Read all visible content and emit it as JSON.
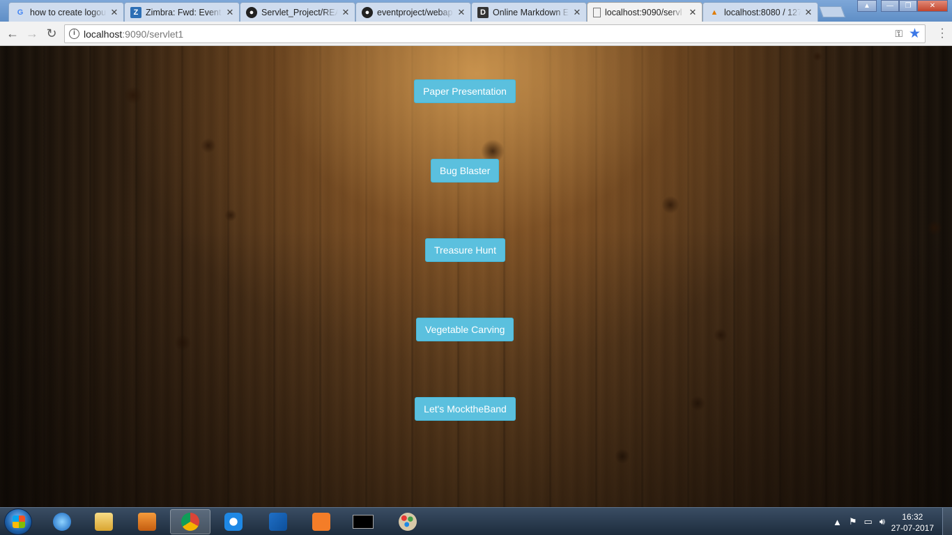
{
  "browser": {
    "tabs": [
      {
        "label": "how to create logou",
        "icon": "google-icon"
      },
      {
        "label": "Zimbra: Fwd: Event",
        "icon": "zimbra-icon"
      },
      {
        "label": "Servlet_Project/REA",
        "icon": "github-icon"
      },
      {
        "label": "eventproject/webap",
        "icon": "github-icon"
      },
      {
        "label": "Online Markdown E",
        "icon": "dillinger-icon"
      },
      {
        "label": "localhost:9090/servl",
        "icon": "page-icon",
        "active": true
      },
      {
        "label": "localhost:8080 / 127",
        "icon": "phpmyadmin-icon"
      }
    ],
    "url_host": "localhost",
    "url_path": ":9090/servlet1"
  },
  "page": {
    "buttons": [
      "Paper Presentation",
      "Bug Blaster",
      "Treasure Hunt",
      "Vegetable Carving",
      "Let's MocktheBand"
    ]
  },
  "taskbar": {
    "time": "16:32",
    "date": "27-07-2017"
  },
  "colors": {
    "button": "#5bc0de",
    "button_text": "#ffffff",
    "accent_star": "#3b78e7"
  }
}
